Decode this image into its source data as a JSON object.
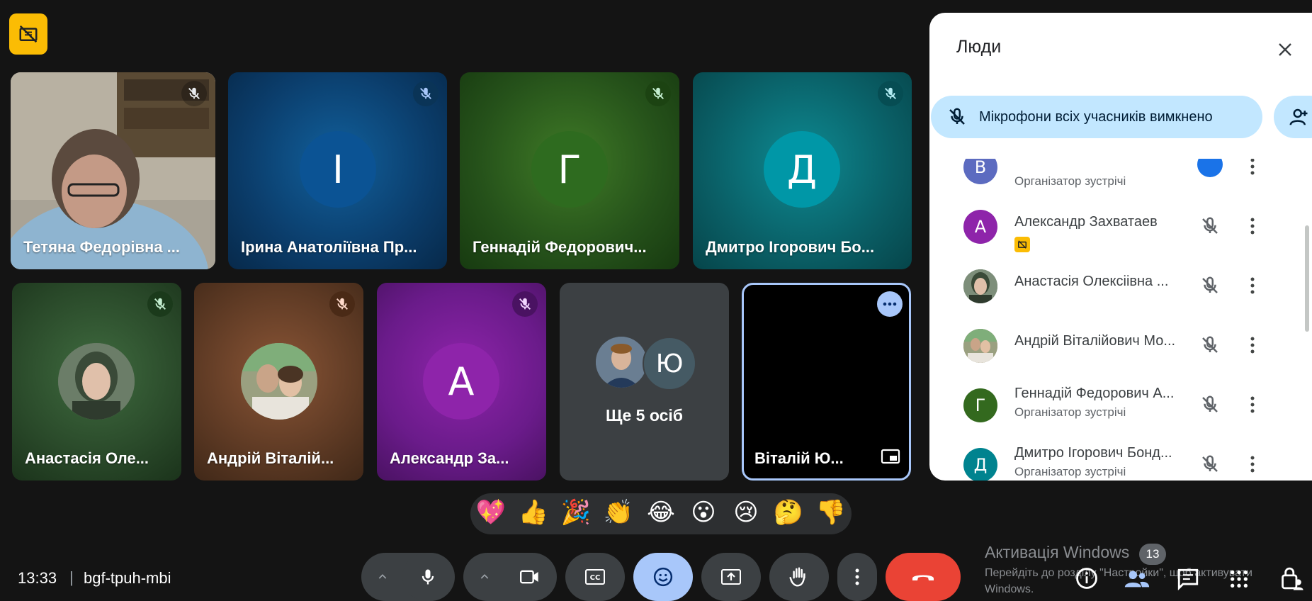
{
  "meeting": {
    "time": "13:33",
    "separator": "|",
    "code": "bgf-tpuh-mbi"
  },
  "tiles_row1": [
    {
      "name": "Тетяна Федорівна ...",
      "type": "photo",
      "color": "#7a8a90"
    },
    {
      "name": "Ірина Анатоліївна Пр...",
      "type": "letter",
      "letter": "І",
      "color": "#0b5394"
    },
    {
      "name": "Геннадій Федорович...",
      "type": "letter",
      "letter": "Г",
      "color": "#2e6b1f"
    },
    {
      "name": "Дмитро Ігорович Бо...",
      "type": "letter",
      "letter": "Д",
      "color": "#0097a7"
    }
  ],
  "tiles_row2": [
    {
      "name": "Анастасія Оле...",
      "type": "photo",
      "color": "#2e5b2e"
    },
    {
      "name": "Андрій Віталій...",
      "type": "photo",
      "color": "#7b4a2e"
    },
    {
      "name": "Александр За...",
      "type": "letter",
      "letter": "А",
      "color": "#8e24aa"
    },
    {
      "name": "Ще 5 осіб",
      "type": "group",
      "letter": "Ю",
      "color": "#3c4043"
    },
    {
      "name": "Віталій Ю...",
      "type": "self",
      "color": "#000000"
    }
  ],
  "panel": {
    "title": "Люди",
    "mute_all_label": "Мікрофони всіх учасників вимкнено",
    "people": [
      {
        "name": "",
        "role": "Організатор зустрічі",
        "letter": "В",
        "color": "#5c6bc0",
        "partial": true
      },
      {
        "name": "Александр Захватаев",
        "role": "",
        "letter": "А",
        "color": "#8e24aa",
        "badge": true
      },
      {
        "name": "Анастасія Олексіівна ...",
        "role": "",
        "letter": "",
        "color": "#4a6b4a"
      },
      {
        "name": "Андрій Віталійович Мо...",
        "role": "",
        "letter": "",
        "color": "#8a6a4a"
      },
      {
        "name": "Геннадій Федорович А...",
        "role": "Організатор зустрічі",
        "letter": "Г",
        "color": "#33691e"
      },
      {
        "name": "Дмитро Ігорович Бонд...",
        "role": "Організатор зустрічі",
        "letter": "Д",
        "color": "#00838f"
      }
    ]
  },
  "reactions": [
    "💖",
    "👍",
    "🎉",
    "👏",
    "😂",
    "😮",
    "😢",
    "🤔",
    "👎"
  ],
  "windows": {
    "title": "Активація Windows",
    "line1": "Перейдіть до розділу \"Настройки\", щоб активувати",
    "line2": "Windows."
  },
  "people_count": "13",
  "colors": {
    "end_call": "#ea4335",
    "reactions_active": "#a8c7fa",
    "highlight_border": "#a8c7fa",
    "warning_badge": "#fbbc04"
  }
}
